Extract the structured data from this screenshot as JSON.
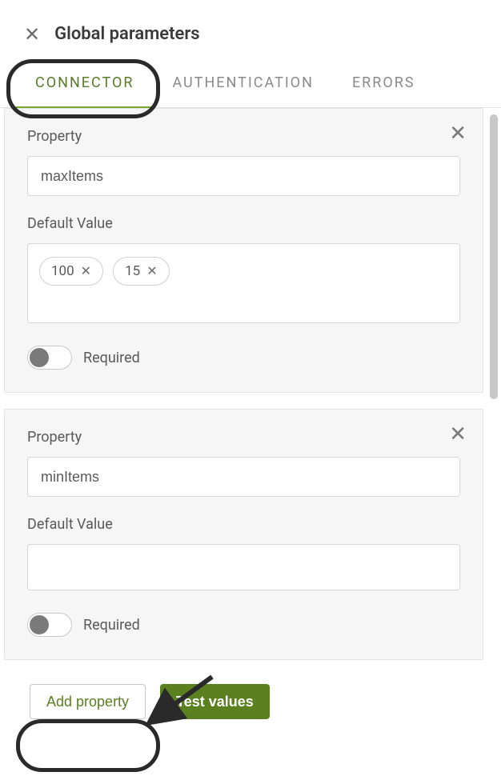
{
  "header": {
    "title": "Global parameters"
  },
  "tabs": [
    {
      "label": "CONNECTOR",
      "active": true
    },
    {
      "label": "AUTHENTICATION",
      "active": false
    },
    {
      "label": "ERRORS",
      "active": false
    }
  ],
  "properties": [
    {
      "propertyLabel": "Property",
      "propertyValue": "maxItems",
      "defaultValueLabel": "Default Value",
      "chips": [
        "100",
        "15"
      ],
      "requiredLabel": "Required",
      "required": false
    },
    {
      "propertyLabel": "Property",
      "propertyValue": "minItems",
      "defaultValueLabel": "Default Value",
      "chips": [],
      "requiredLabel": "Required",
      "required": false
    }
  ],
  "footer": {
    "addPropertyLabel": "Add property",
    "testValuesLabel": "Test values"
  }
}
